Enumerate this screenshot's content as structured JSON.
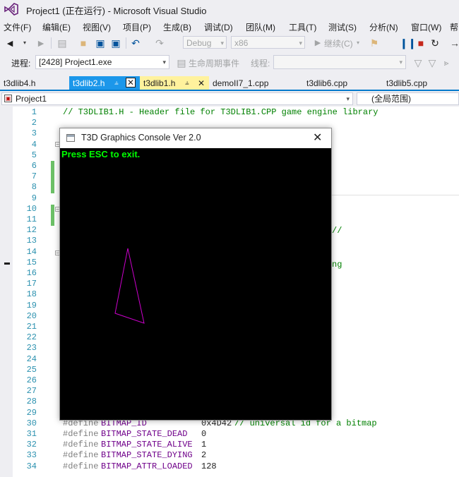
{
  "window": {
    "title": "Project1 (正在运行) - Microsoft Visual Studio"
  },
  "menu": [
    "文件(F)",
    "编辑(E)",
    "视图(V)",
    "项目(P)",
    "生成(B)",
    "调试(D)",
    "团队(M)",
    "工具(T)",
    "测试(S)",
    "分析(N)",
    "窗口(W)",
    "帮"
  ],
  "toolbar": {
    "config": "Debug",
    "platform": "x86",
    "continue_label": "继续(C)"
  },
  "debugbar": {
    "process_label": "进程:",
    "process_value": "[2428] Project1.exe",
    "lifecycle_label": "生命周期事件",
    "thread_label": "线程:"
  },
  "tabs": [
    {
      "label": "t3dlib4.h"
    },
    {
      "label": "t3dlib2.h"
    },
    {
      "label": "t3dlib1.h"
    },
    {
      "label": "demoII7_1.cpp"
    },
    {
      "label": "t3dlib6.cpp"
    },
    {
      "label": "t3dlib5.cpp"
    }
  ],
  "navbar": {
    "project": "Project1",
    "scope": "(全局范围)"
  },
  "editor": {
    "line_numbers": [
      "1",
      "2",
      "3",
      "4",
      "5",
      "6",
      "7",
      "8",
      "9",
      "10",
      "11",
      "12",
      "13",
      "14",
      "15",
      "16",
      "17",
      "18",
      "19",
      "20",
      "21",
      "22",
      "23",
      "24",
      "25",
      "26",
      "27",
      "28",
      "29",
      "30",
      "31",
      "32",
      "33",
      "34"
    ],
    "line1_comment": "// T3DLIB1.H - Header file for T3DLIB1.CPP game engine library",
    "line11_fragment": "//",
    "line15_fragment": "ng",
    "defines": [
      {
        "kw": "#define",
        "name": "BITMAP_ID",
        "value": "0x4D42",
        "comment": "// universal id for a bitmap"
      },
      {
        "kw": "#define",
        "name": "BITMAP_STATE_DEAD",
        "value": "0",
        "comment": ""
      },
      {
        "kw": "#define",
        "name": "BITMAP_STATE_ALIVE",
        "value": "1",
        "comment": ""
      },
      {
        "kw": "#define",
        "name": "BITMAP_STATE_DYING",
        "value": "2",
        "comment": ""
      },
      {
        "kw": "#define",
        "name": "BITMAP_ATTR_LOADED",
        "value": "128",
        "comment": ""
      }
    ]
  },
  "console": {
    "title": "T3D Graphics Console Ver 2.0",
    "message": "Press ESC to exit.",
    "message_color": "#00ff00",
    "triangle_color": "#cc00cc"
  },
  "colors": {
    "accent": "#007acc",
    "active_tab_bg": "#fff29d",
    "tab_hover_bg": "#1c97ea"
  }
}
